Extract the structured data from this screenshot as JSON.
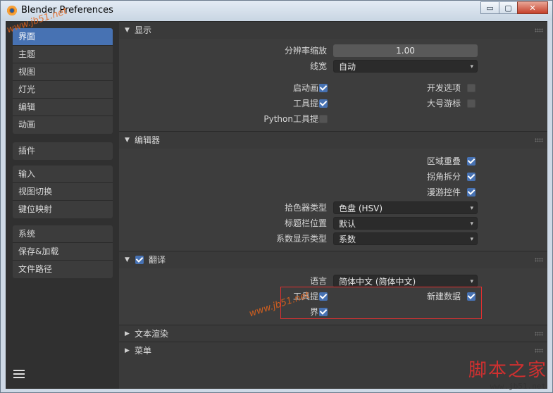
{
  "window": {
    "title": "Blender Preferences",
    "minimize": "▭",
    "restore": "▢",
    "close": "✕"
  },
  "sidebar": {
    "group1": [
      {
        "label": "界面",
        "active": true
      },
      {
        "label": "主题"
      },
      {
        "label": "视图"
      },
      {
        "label": "灯光"
      },
      {
        "label": "编辑"
      },
      {
        "label": "动画"
      }
    ],
    "group2": [
      {
        "label": "插件"
      }
    ],
    "group3": [
      {
        "label": "输入"
      },
      {
        "label": "视图切换"
      },
      {
        "label": "键位映射"
      }
    ],
    "group4": [
      {
        "label": "系统"
      },
      {
        "label": "保存&加载"
      },
      {
        "label": "文件路径"
      }
    ]
  },
  "display": {
    "title": "显示",
    "resolution_scale_label": "分辨率缩放",
    "resolution_scale_value": "1.00",
    "line_width_label": "线宽",
    "line_width_value": "自动",
    "splash_label": "启动画面",
    "tooltips_label": "工具提示",
    "python_tooltips_label": "Python工具提示",
    "dev_extras_label": "开发选项",
    "large_cursors_label": "大号游标"
  },
  "editors": {
    "title": "编辑器",
    "region_overlap_label": "区域重叠",
    "corner_splitting_label": "拐角拆分",
    "navigation_controls_label": "漫游控件",
    "color_picker_label": "拾色器类型",
    "color_picker_value": "色盘 (HSV)",
    "header_position_label": "标题栏位置",
    "header_position_value": "默认",
    "factor_display_label": "系数显示类型",
    "factor_display_value": "系数"
  },
  "translation": {
    "title": "翻译",
    "language_label": "语言",
    "language_value": "简体中文 (简体中文)",
    "tooltips_label": "工具提示",
    "interface_label": "界面",
    "new_data_label": "新建数据"
  },
  "text_rendering": {
    "title": "文本渲染"
  },
  "menus": {
    "title": "菜单"
  },
  "watermarks": {
    "top_left": "www.jb51.net",
    "middle": "www.jb51.net",
    "logo": "脚本之家",
    "url": "www.jb51.net"
  },
  "colors": {
    "accent": "#4772b3",
    "highlight_box": "#e03030"
  }
}
